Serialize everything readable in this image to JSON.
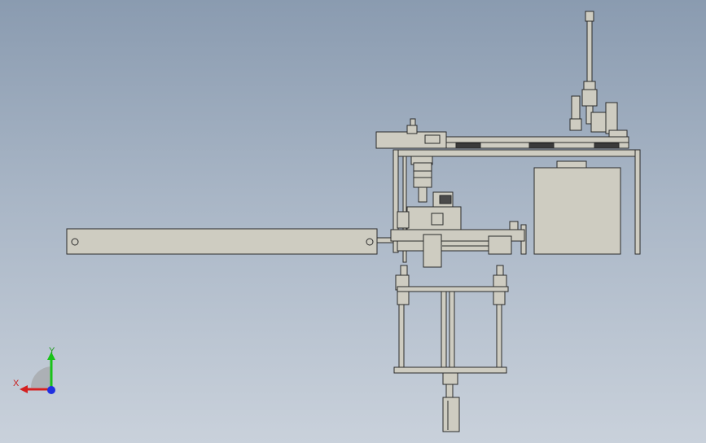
{
  "viewport": {
    "background": [
      "#8a9bb0",
      "#c9d1db"
    ],
    "part_fill": "#ceccc1",
    "part_stroke": "#2b2b2b"
  },
  "triad": {
    "y_label": "Y",
    "x_label": "X",
    "y_color": "#19c219",
    "x_color": "#d42020",
    "z_color": "#2030e0",
    "y_label_color": "#1d9a1d",
    "x_label_color": "#c81e1e"
  }
}
